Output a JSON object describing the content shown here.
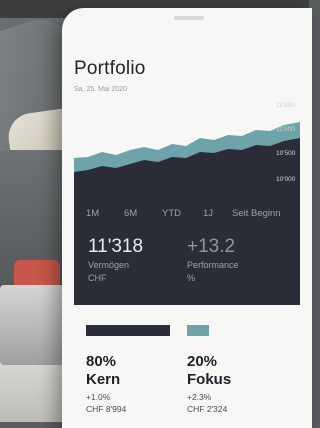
{
  "screen": {
    "title": "Portfolio",
    "date": "Sa, 25. Mai 2020"
  },
  "chart": {
    "y_ticks": [
      "11'500",
      "11'000",
      "10'500",
      "10'000"
    ],
    "ranges": [
      "1M",
      "6M",
      "YTD",
      "1J",
      "Seit Beginn"
    ],
    "colors": {
      "area": "#6fa3aa",
      "background": "#2a2d38"
    }
  },
  "summary": {
    "value": "11'318",
    "value_label": "Vermögen",
    "value_unit": "CHF",
    "performance": "+13.2",
    "performance_label": "Performance",
    "performance_unit": "%"
  },
  "allocation": [
    {
      "pct": "80%",
      "name": "Kern",
      "change": "+1.0%",
      "amount": "CHF 8'994",
      "color": "#2a2d38",
      "share": 0.8
    },
    {
      "pct": "20%",
      "name": "Fokus",
      "change": "+2.3%",
      "amount": "CHF 2'324",
      "color": "#6fa3aa",
      "share": 0.2
    }
  ]
}
